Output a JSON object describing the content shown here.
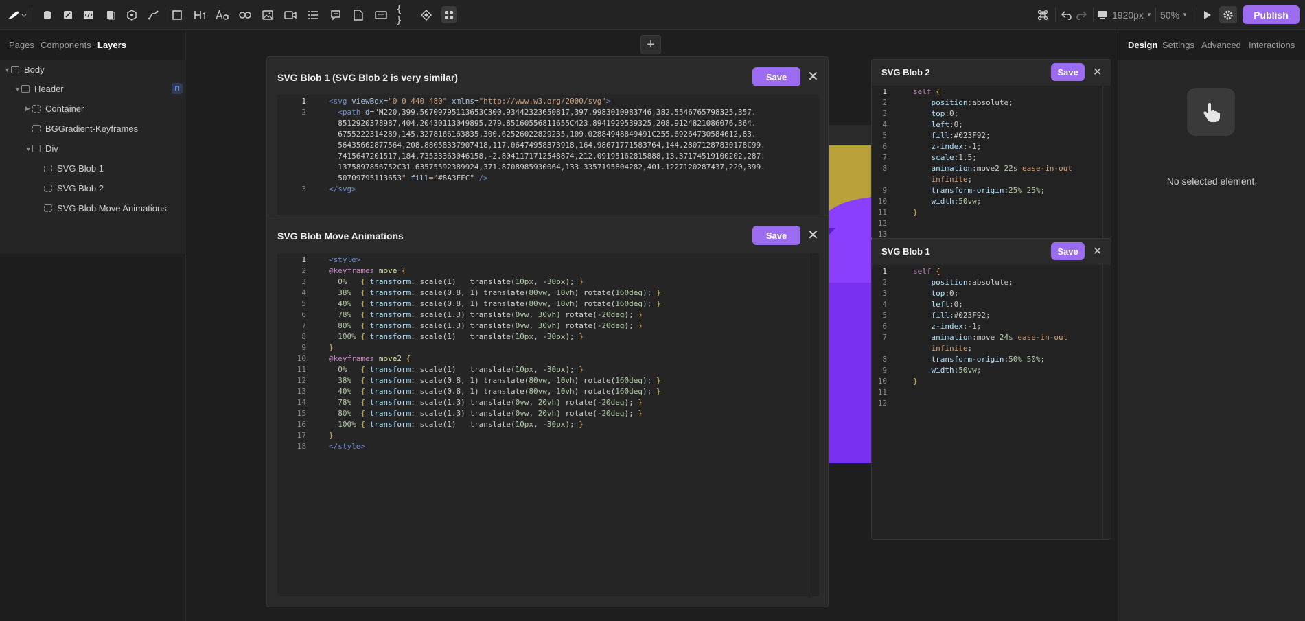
{
  "toolbar": {
    "viewport_label": "1920px",
    "zoom_label": "50%",
    "publish_label": "Publish"
  },
  "left_panel": {
    "tabs": [
      "Pages",
      "Components",
      "Layers"
    ],
    "layers": [
      {
        "label": "Body"
      },
      {
        "label": "Header"
      },
      {
        "label": "Container"
      },
      {
        "label": "BGGradient-Keyframes"
      },
      {
        "label": "Div"
      },
      {
        "label": "SVG Blob 1"
      },
      {
        "label": "SVG Blob 2"
      },
      {
        "label": "SVG Blob Move Animations"
      }
    ]
  },
  "right_panel": {
    "tabs": [
      "Design",
      "Settings",
      "Advanced",
      "Interactions"
    ],
    "empty_message": "No selected element."
  },
  "panels": {
    "svg_blob1_main": {
      "title": "SVG Blob 1 (SVG Blob 2 is very similar)",
      "save_label": "Save",
      "line_numbers": [
        "1",
        "2",
        "",
        "",
        "",
        "",
        "",
        "",
        "3"
      ],
      "lines": [
        "<svg viewBox=\"0 0 440 480\" xmlns=\"http://www.w3.org/2000/svg\">",
        "  <path d=\"M220,399.50709795113653C300.93442323650817,397.9983010983746,382.5546765798325,357.",
        "  8512920378987,404.20430113049895,279.85160556811655C423.8941929539325,208.9124821086076,364.",
        "  6755222314289,145.3278166163835,300.62526022829235,109.02884948849491C255.69264730584612,83.",
        "  56435662877564,208.88058337907418,117.06474958873918,164.98671771583764,144.28071287830178C99.",
        "  7415647201517,184.73533363046158,-2.8041171712548874,212.09195162815888,13.37174519100202,287.",
        "  1375897856752C31.63575592389924,371.8708985930064,133.3357195804282,401.1227120287437,220,399.",
        "  50709795113653\" fill=\"#8A3FFC\" />",
        "</svg>"
      ]
    },
    "move_animations": {
      "title": "SVG Blob Move Animations",
      "save_label": "Save",
      "line_numbers": [
        "1",
        "2",
        "3",
        "4",
        "5",
        "6",
        "7",
        "8",
        "9",
        "10",
        "11",
        "12",
        "13",
        "14",
        "15",
        "16",
        "17",
        "18"
      ],
      "lines": [
        "<style>",
        "@keyframes move {",
        "  0%   { transform: scale(1)   translate(10px, -30px); }",
        "  38%  { transform: scale(0.8, 1) translate(80vw, 10vh) rotate(160deg); }",
        "  40%  { transform: scale(0.8, 1) translate(80vw, 10vh) rotate(160deg); }",
        "  78%  { transform: scale(1.3) translate(0vw, 30vh) rotate(-20deg); }",
        "  80%  { transform: scale(1.3) translate(0vw, 30vh) rotate(-20deg); }",
        "  100% { transform: scale(1)   translate(10px, -30px); }",
        "}",
        "@keyframes move2 {",
        "  0%   { transform: scale(1)   translate(10px, -30px); }",
        "  38%  { transform: scale(0.8, 1) translate(80vw, 10vh) rotate(160deg); }",
        "  40%  { transform: scale(0.8, 1) translate(80vw, 10vh) rotate(160deg); }",
        "  78%  { transform: scale(1.3) translate(0vw, 20vh) rotate(-20deg); }",
        "  80%  { transform: scale(1.3) translate(0vw, 20vh) rotate(-20deg); }",
        "  100% { transform: scale(1)   translate(10px, -30px); }",
        "}",
        "</style>"
      ]
    },
    "svg_blob2": {
      "title": "SVG Blob 2",
      "save_label": "Save",
      "line_numbers": [
        "1",
        "2",
        "3",
        "4",
        "5",
        "6",
        "7",
        "8",
        "",
        "9",
        "10",
        "11",
        "12",
        "13"
      ],
      "lines": [
        "self {",
        "    position:absolute;",
        "    top:0;",
        "    left:0;",
        "    fill:#023F92;",
        "    z-index:-1;",
        "    scale:1.5;",
        "    animation:move2 22s ease-in-out",
        "    infinite;",
        "    transform-origin:25% 25%;",
        "    width:50vw;",
        "}",
        "",
        ""
      ]
    },
    "svg_blob1": {
      "title": "SVG Blob 1",
      "save_label": "Save",
      "line_numbers": [
        "1",
        "2",
        "3",
        "4",
        "5",
        "6",
        "7",
        "",
        "8",
        "9",
        "10",
        "11",
        "12"
      ],
      "lines": [
        "self {",
        "    position:absolute;",
        "    top:0;",
        "    left:0;",
        "    fill:#023F92;",
        "    z-index:-1;",
        "    animation:move 24s ease-in-out",
        "    infinite;",
        "    transform-origin:50% 50%;",
        "    width:50vw;",
        "}",
        "",
        ""
      ]
    }
  },
  "colors": {
    "accent": "#9b6cf0",
    "canvas_purple": "#5a1ecf",
    "canvas_yellow": "#b9a23a"
  }
}
